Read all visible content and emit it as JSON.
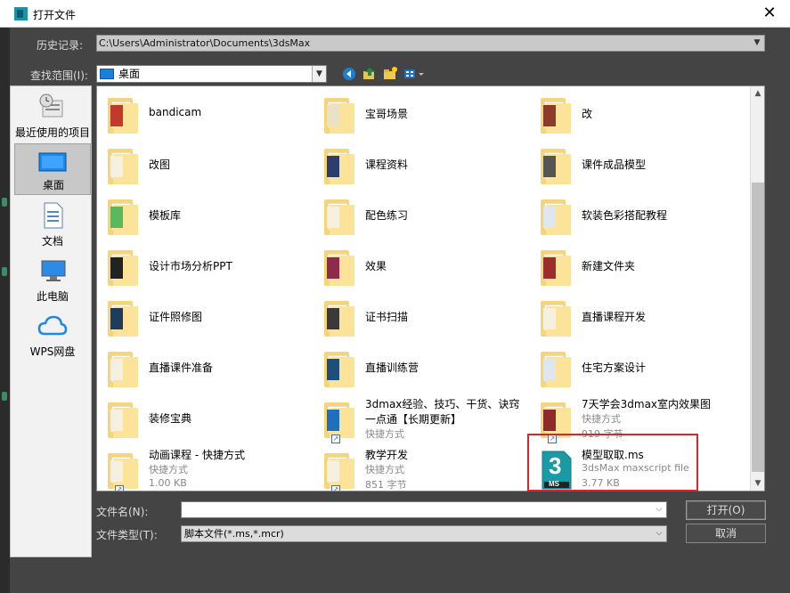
{
  "window": {
    "title": "打开文件",
    "close_glyph": "✕"
  },
  "history": {
    "label": "历史记录:",
    "value": "C:\\Users\\Administrator\\Documents\\3dsMax"
  },
  "lookin": {
    "label": "查找范围(I):",
    "value": "桌面",
    "toolbar_icons": [
      "back-icon",
      "up-folder-icon",
      "new-folder-icon",
      "view-menu-icon"
    ]
  },
  "places": [
    {
      "label": "最近使用的项目",
      "icon": "recent-icon"
    },
    {
      "label": "桌面",
      "icon": "desktop-icon"
    },
    {
      "label": "文档",
      "icon": "documents-icon"
    },
    {
      "label": "此电脑",
      "icon": "this-pc-icon"
    },
    {
      "label": "WPS网盘",
      "icon": "cloud-icon"
    }
  ],
  "files": [
    {
      "name": "bandicam",
      "line2": "",
      "line3": "",
      "thumb": "#c0392b"
    },
    {
      "name": "宝哥场景",
      "line2": "",
      "line3": "",
      "thumb": "#e9e2c8"
    },
    {
      "name": "改",
      "line2": "",
      "line3": "",
      "thumb": "#8e3a2a"
    },
    {
      "name": "改图",
      "line2": "",
      "line3": "",
      "thumb": "#f5f0e0"
    },
    {
      "name": "课程资料",
      "line2": "",
      "line3": "",
      "thumb": "#2c3e6b"
    },
    {
      "name": "课件成品模型",
      "line2": "",
      "line3": "",
      "thumb": "#555555"
    },
    {
      "name": "模板库",
      "line2": "",
      "line3": "",
      "thumb": "#5cb85c"
    },
    {
      "name": "配色练习",
      "line2": "",
      "line3": "",
      "thumb": "#f5f0e0"
    },
    {
      "name": "软装色彩搭配教程",
      "line2": "",
      "line3": "",
      "thumb": "#dfe6ee"
    },
    {
      "name": "设计市场分析PPT",
      "line2": "",
      "line3": "",
      "thumb": "#222222"
    },
    {
      "name": "效果",
      "line2": "",
      "line3": "",
      "thumb": "#8e2a4a"
    },
    {
      "name": "新建文件夹",
      "line2": "",
      "line3": "",
      "thumb": "#9b2d2d"
    },
    {
      "name": "证件照修图",
      "line2": "",
      "line3": "",
      "thumb": "#1f3b5c"
    },
    {
      "name": "证书扫描",
      "line2": "",
      "line3": "",
      "thumb": "#3a3a3a"
    },
    {
      "name": "直播课程开发",
      "line2": "",
      "line3": "",
      "thumb": "#f5f0e0"
    },
    {
      "name": "直播课件准备",
      "line2": "",
      "line3": "",
      "thumb": "#f5f0e0"
    },
    {
      "name": "直播训练营",
      "line2": "",
      "line3": "",
      "thumb": "#1d4f7a"
    },
    {
      "name": "住宅方案设计",
      "line2": "",
      "line3": "",
      "thumb": "#dfe6ee"
    },
    {
      "name": "装修宝典",
      "line2": "",
      "line3": "",
      "thumb": "#f5f0e0"
    },
    {
      "name": "3dmax经验、技巧、干货、诀窍",
      "name2": "一点通【长期更新】",
      "line2": "快捷方式",
      "line3": "",
      "thumb": "#1f6fbf",
      "shortcut": true
    },
    {
      "name": "7天学会3dmax室内效果图",
      "line2": "快捷方式",
      "line3": "919 字节",
      "thumb": "#8e2a2a",
      "shortcut": true
    },
    {
      "name": "动画课程 - 快捷方式",
      "line2": "快捷方式",
      "line3": "1.00 KB",
      "thumb": "#f5f0e0",
      "shortcut": true
    },
    {
      "name": "教学开发",
      "line2": "快捷方式",
      "line3": "851 字节",
      "thumb": "#f5f0e0",
      "shortcut": true
    },
    {
      "name": "模型取取.ms",
      "line2": "3dsMax maxscript file",
      "line3": "3.77 KB",
      "thumb": "ms",
      "ms_digit": "3",
      "ms_text": "MS"
    }
  ],
  "filename": {
    "label": "文件名(N):",
    "value": ""
  },
  "filetype": {
    "label": "文件类型(T):",
    "value": "脚本文件(*.ms,*.mcr)"
  },
  "buttons": {
    "open": "打开(O)",
    "cancel": "取消"
  },
  "colors": {
    "dialog_bg": "#444444",
    "highlight_border": "#e0232a",
    "folder": "#f5d576"
  }
}
